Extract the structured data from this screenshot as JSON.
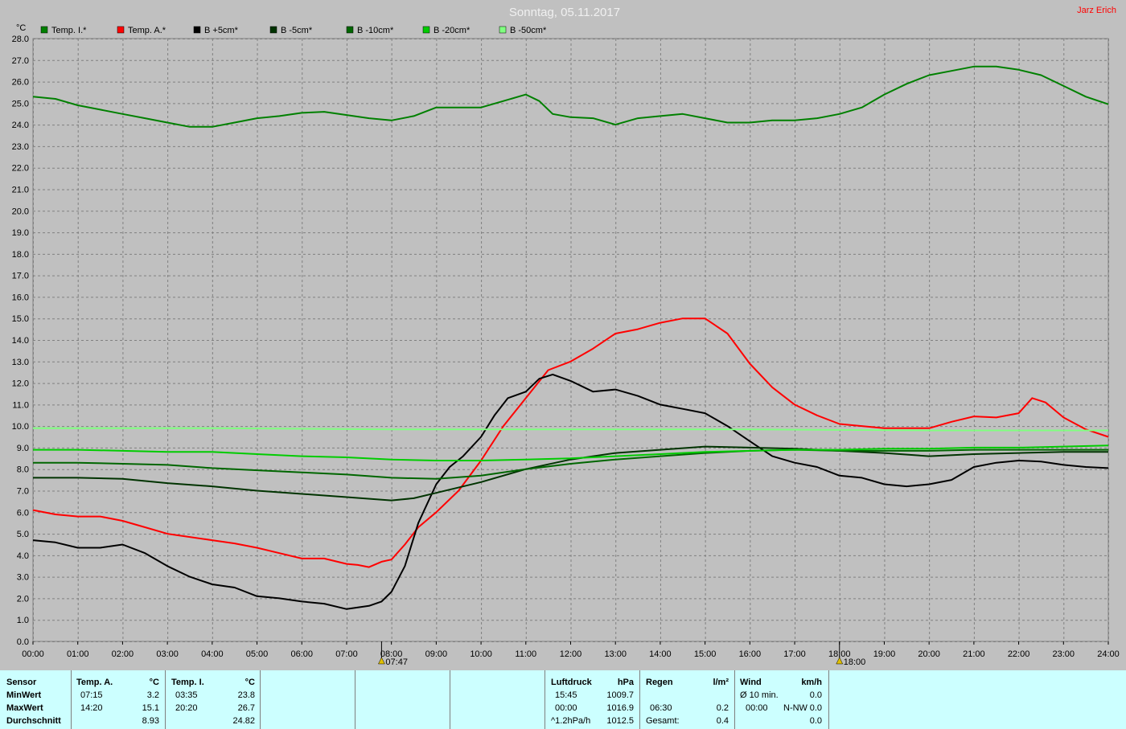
{
  "title": "Sonntag, 05.11.2017",
  "author": "Jarz Erich",
  "colors": {
    "background": "#c0c0c0",
    "plot_bg": "#c0c0c0",
    "grid": "#808080",
    "author": "#ff0000",
    "stats_bg": "#ccffff"
  },
  "chart_data": {
    "type": "line",
    "ylabel": "°C",
    "ylim": [
      0,
      28
    ],
    "y_ticks": [
      "0.0",
      "1.0",
      "2.0",
      "3.0",
      "4.0",
      "5.0",
      "6.0",
      "7.0",
      "8.0",
      "9.0",
      "10.0",
      "11.0",
      "12.0",
      "13.0",
      "14.0",
      "15.0",
      "16.0",
      "17.0",
      "18.0",
      "19.0",
      "20.0",
      "21.0",
      "22.0",
      "23.0",
      "24.0",
      "25.0",
      "26.0",
      "27.0",
      "28.0"
    ],
    "x_ticks": [
      "00:00",
      "01:00",
      "02:00",
      "03:00",
      "04:00",
      "05:00",
      "06:00",
      "07:00",
      "08:00",
      "09:00",
      "10:00",
      "11:00",
      "12:00",
      "13:00",
      "14:00",
      "15:00",
      "16:00",
      "17:00",
      "18:00",
      "19:00",
      "20:00",
      "21:00",
      "22:00",
      "23:00",
      "24:00"
    ],
    "xlim": [
      0,
      24
    ],
    "grid": true,
    "legend_position": "top",
    "markers": [
      {
        "label": "07:47",
        "x": 7.78,
        "icon": "sunrise-icon"
      },
      {
        "label": "18:00",
        "x": 18.0,
        "icon": "sunset-icon"
      }
    ],
    "series": [
      {
        "name": "Temp. I.*",
        "color": "#008000",
        "points": [
          [
            0,
            25.3
          ],
          [
            0.5,
            25.2
          ],
          [
            1,
            24.9
          ],
          [
            1.5,
            24.7
          ],
          [
            2,
            24.5
          ],
          [
            2.5,
            24.3
          ],
          [
            3,
            24.1
          ],
          [
            3.5,
            23.9
          ],
          [
            4,
            23.9
          ],
          [
            4.5,
            24.1
          ],
          [
            5,
            24.3
          ],
          [
            5.5,
            24.4
          ],
          [
            6,
            24.55
          ],
          [
            6.5,
            24.6
          ],
          [
            7,
            24.45
          ],
          [
            7.5,
            24.3
          ],
          [
            8,
            24.2
          ],
          [
            8.5,
            24.4
          ],
          [
            9,
            24.8
          ],
          [
            9.5,
            24.8
          ],
          [
            10,
            24.8
          ],
          [
            10.5,
            25.1
          ],
          [
            11,
            25.4
          ],
          [
            11.3,
            25.1
          ],
          [
            11.6,
            24.5
          ],
          [
            12,
            24.35
          ],
          [
            12.5,
            24.3
          ],
          [
            13,
            24.0
          ],
          [
            13.5,
            24.3
          ],
          [
            14,
            24.4
          ],
          [
            14.5,
            24.5
          ],
          [
            15,
            24.3
          ],
          [
            15.5,
            24.1
          ],
          [
            16,
            24.1
          ],
          [
            16.5,
            24.2
          ],
          [
            17,
            24.2
          ],
          [
            17.5,
            24.3
          ],
          [
            18,
            24.5
          ],
          [
            18.5,
            24.8
          ],
          [
            19,
            25.4
          ],
          [
            19.5,
            25.9
          ],
          [
            20,
            26.3
          ],
          [
            20.5,
            26.5
          ],
          [
            21,
            26.7
          ],
          [
            21.5,
            26.7
          ],
          [
            22,
            26.55
          ],
          [
            22.5,
            26.3
          ],
          [
            23,
            25.8
          ],
          [
            23.5,
            25.3
          ],
          [
            24,
            24.95
          ]
        ]
      },
      {
        "name": "Temp. A.*",
        "color": "#ff0000",
        "points": [
          [
            0,
            6.1
          ],
          [
            0.5,
            5.9
          ],
          [
            1,
            5.8
          ],
          [
            1.5,
            5.8
          ],
          [
            2,
            5.6
          ],
          [
            2.5,
            5.3
          ],
          [
            3,
            5.0
          ],
          [
            3.5,
            4.85
          ],
          [
            4,
            4.7
          ],
          [
            4.5,
            4.55
          ],
          [
            5,
            4.35
          ],
          [
            5.5,
            4.1
          ],
          [
            6,
            3.85
          ],
          [
            6.5,
            3.85
          ],
          [
            7,
            3.6
          ],
          [
            7.25,
            3.55
          ],
          [
            7.5,
            3.45
          ],
          [
            7.78,
            3.7
          ],
          [
            8,
            3.8
          ],
          [
            8.3,
            4.5
          ],
          [
            8.6,
            5.3
          ],
          [
            9,
            6.0
          ],
          [
            9.5,
            7.0
          ],
          [
            10,
            8.4
          ],
          [
            10.5,
            10.0
          ],
          [
            11,
            11.3
          ],
          [
            11.5,
            12.6
          ],
          [
            12,
            13.0
          ],
          [
            12.5,
            13.6
          ],
          [
            13,
            14.3
          ],
          [
            13.5,
            14.5
          ],
          [
            14,
            14.8
          ],
          [
            14.5,
            15.0
          ],
          [
            15,
            15.0
          ],
          [
            15.5,
            14.3
          ],
          [
            16,
            12.9
          ],
          [
            16.5,
            11.8
          ],
          [
            17,
            11.0
          ],
          [
            17.5,
            10.5
          ],
          [
            18,
            10.1
          ],
          [
            18.5,
            10.0
          ],
          [
            19,
            9.9
          ],
          [
            19.5,
            9.9
          ],
          [
            20,
            9.9
          ],
          [
            20.5,
            10.2
          ],
          [
            21,
            10.45
          ],
          [
            21.5,
            10.4
          ],
          [
            22,
            10.6
          ],
          [
            22.3,
            11.3
          ],
          [
            22.6,
            11.1
          ],
          [
            23,
            10.4
          ],
          [
            23.5,
            9.85
          ],
          [
            24,
            9.5
          ]
        ]
      },
      {
        "name": "B +5cm*",
        "color": "#000000",
        "points": [
          [
            0,
            4.7
          ],
          [
            0.5,
            4.6
          ],
          [
            1,
            4.35
          ],
          [
            1.5,
            4.35
          ],
          [
            2,
            4.5
          ],
          [
            2.5,
            4.1
          ],
          [
            3,
            3.5
          ],
          [
            3.5,
            3.0
          ],
          [
            4,
            2.65
          ],
          [
            4.5,
            2.5
          ],
          [
            5,
            2.1
          ],
          [
            5.5,
            2.0
          ],
          [
            6,
            1.85
          ],
          [
            6.5,
            1.75
          ],
          [
            7,
            1.5
          ],
          [
            7.5,
            1.65
          ],
          [
            7.78,
            1.85
          ],
          [
            8,
            2.3
          ],
          [
            8.3,
            3.5
          ],
          [
            8.6,
            5.5
          ],
          [
            9,
            7.3
          ],
          [
            9.3,
            8.1
          ],
          [
            9.6,
            8.6
          ],
          [
            10,
            9.5
          ],
          [
            10.3,
            10.5
          ],
          [
            10.6,
            11.3
          ],
          [
            11,
            11.6
          ],
          [
            11.3,
            12.2
          ],
          [
            11.6,
            12.4
          ],
          [
            12,
            12.1
          ],
          [
            12.5,
            11.6
          ],
          [
            13,
            11.7
          ],
          [
            13.5,
            11.4
          ],
          [
            14,
            11.0
          ],
          [
            14.5,
            10.8
          ],
          [
            15,
            10.6
          ],
          [
            15.5,
            10.0
          ],
          [
            16,
            9.3
          ],
          [
            16.5,
            8.6
          ],
          [
            17,
            8.3
          ],
          [
            17.5,
            8.1
          ],
          [
            18,
            7.7
          ],
          [
            18.5,
            7.6
          ],
          [
            19,
            7.3
          ],
          [
            19.5,
            7.2
          ],
          [
            20,
            7.3
          ],
          [
            20.5,
            7.5
          ],
          [
            21,
            8.1
          ],
          [
            21.5,
            8.3
          ],
          [
            22,
            8.4
          ],
          [
            22.5,
            8.35
          ],
          [
            23,
            8.2
          ],
          [
            23.5,
            8.1
          ],
          [
            24,
            8.05
          ]
        ]
      },
      {
        "name": "B -5cm*",
        "color": "#003300",
        "points": [
          [
            0,
            7.6
          ],
          [
            1,
            7.6
          ],
          [
            2,
            7.55
          ],
          [
            3,
            7.35
          ],
          [
            4,
            7.2
          ],
          [
            5,
            7.0
          ],
          [
            6,
            6.85
          ],
          [
            7,
            6.7
          ],
          [
            8,
            6.55
          ],
          [
            8.5,
            6.65
          ],
          [
            9,
            6.9
          ],
          [
            10,
            7.4
          ],
          [
            11,
            8.0
          ],
          [
            12,
            8.45
          ],
          [
            13,
            8.75
          ],
          [
            14,
            8.9
          ],
          [
            15,
            9.05
          ],
          [
            16,
            9.0
          ],
          [
            17,
            8.95
          ],
          [
            18,
            8.85
          ],
          [
            19,
            8.75
          ],
          [
            20,
            8.6
          ],
          [
            21,
            8.7
          ],
          [
            22,
            8.75
          ],
          [
            23,
            8.8
          ],
          [
            24,
            8.8
          ]
        ]
      },
      {
        "name": "B -10cm*",
        "color": "#006600",
        "points": [
          [
            0,
            8.3
          ],
          [
            1,
            8.3
          ],
          [
            2,
            8.25
          ],
          [
            3,
            8.2
          ],
          [
            4,
            8.05
          ],
          [
            5,
            7.95
          ],
          [
            6,
            7.85
          ],
          [
            7,
            7.75
          ],
          [
            8,
            7.6
          ],
          [
            9,
            7.55
          ],
          [
            10,
            7.7
          ],
          [
            11,
            8.0
          ],
          [
            12,
            8.25
          ],
          [
            13,
            8.45
          ],
          [
            14,
            8.6
          ],
          [
            15,
            8.75
          ],
          [
            16,
            8.85
          ],
          [
            17,
            8.9
          ],
          [
            18,
            8.85
          ],
          [
            19,
            8.85
          ],
          [
            20,
            8.85
          ],
          [
            21,
            8.9
          ],
          [
            22,
            8.9
          ],
          [
            23,
            8.9
          ],
          [
            24,
            8.9
          ]
        ]
      },
      {
        "name": "B -20cm*",
        "color": "#00cc00",
        "points": [
          [
            0,
            8.9
          ],
          [
            1,
            8.9
          ],
          [
            2,
            8.85
          ],
          [
            3,
            8.8
          ],
          [
            4,
            8.8
          ],
          [
            5,
            8.7
          ],
          [
            6,
            8.6
          ],
          [
            7,
            8.55
          ],
          [
            8,
            8.45
          ],
          [
            9,
            8.4
          ],
          [
            10,
            8.4
          ],
          [
            11,
            8.45
          ],
          [
            12,
            8.5
          ],
          [
            13,
            8.6
          ],
          [
            14,
            8.7
          ],
          [
            15,
            8.8
          ],
          [
            16,
            8.85
          ],
          [
            17,
            8.9
          ],
          [
            18,
            8.9
          ],
          [
            19,
            8.95
          ],
          [
            20,
            8.95
          ],
          [
            21,
            9.0
          ],
          [
            22,
            9.0
          ],
          [
            23,
            9.05
          ],
          [
            24,
            9.1
          ]
        ]
      },
      {
        "name": "B -50cm*",
        "color": "#80ff80",
        "points": [
          [
            0,
            9.9
          ],
          [
            4,
            9.9
          ],
          [
            8,
            9.85
          ],
          [
            12,
            9.85
          ],
          [
            16,
            9.85
          ],
          [
            20,
            9.8
          ],
          [
            24,
            9.8
          ]
        ]
      }
    ]
  },
  "stats": {
    "sensor": {
      "header": "Sensor",
      "rows": [
        "MinWert",
        "MaxWert",
        "Durchschnitt"
      ]
    },
    "temp_a": {
      "header": "Temp. A.",
      "unit": "°C",
      "rows": [
        [
          "07:15",
          "3.2"
        ],
        [
          "14:20",
          "15.1"
        ],
        [
          "",
          "8.93"
        ]
      ]
    },
    "temp_i": {
      "header": "Temp. I.",
      "unit": "°C",
      "rows": [
        [
          "03:35",
          "23.8"
        ],
        [
          "20:20",
          "26.7"
        ],
        [
          "",
          "24.82"
        ]
      ]
    },
    "pressure": {
      "header": "Luftdruck",
      "unit": "hPa",
      "rows": [
        [
          "15:45",
          "1009.7"
        ],
        [
          "00:00",
          "1016.9"
        ],
        [
          "^1.2hPa/h",
          "1012.5"
        ]
      ]
    },
    "rain": {
      "header": "Regen",
      "unit": "l/m²",
      "rows": [
        [
          "",
          ""
        ],
        [
          "06:30",
          "0.2"
        ],
        [
          "Gesamt:",
          "0.4"
        ]
      ]
    },
    "wind": {
      "header": "Wind",
      "unit": "km/h",
      "rows": [
        [
          "Ø 10 min.",
          "",
          "0.0"
        ],
        [
          "00:00",
          "N-NW",
          "0.0"
        ],
        [
          "",
          "",
          "0.0"
        ]
      ]
    }
  }
}
